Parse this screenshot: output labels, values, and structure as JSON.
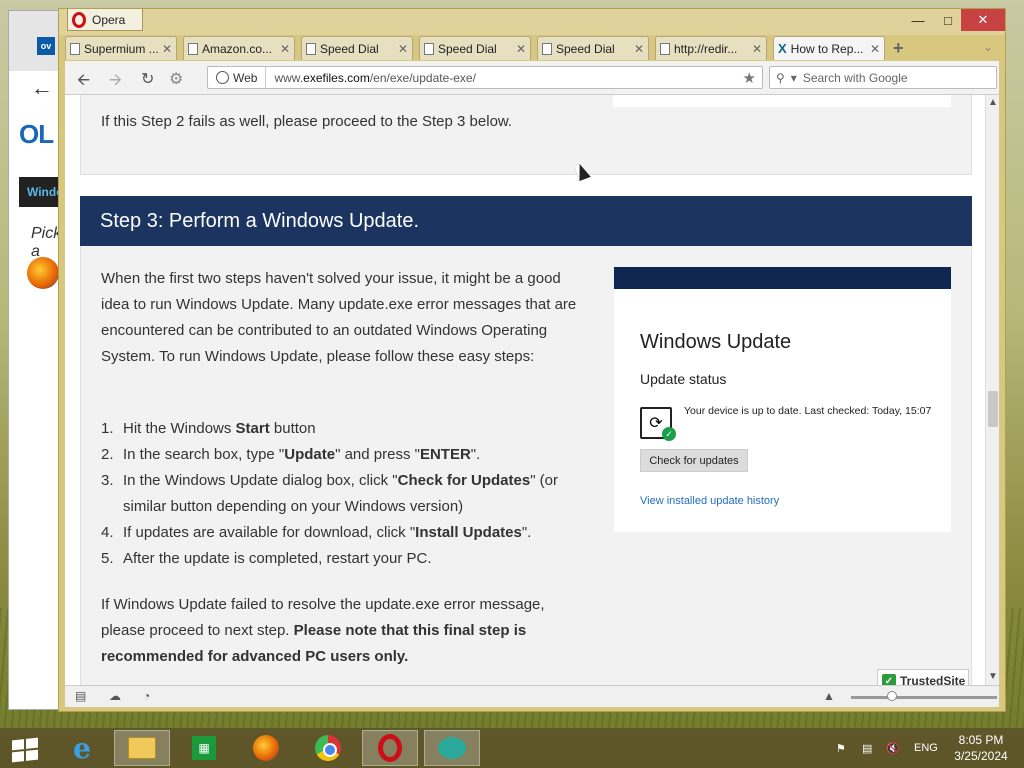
{
  "background_window": {
    "badge": "ov",
    "logo_text": "OL",
    "nav_text": "Window",
    "pick_text": "Pick a"
  },
  "browser": {
    "app_name": "Opera",
    "tabs": [
      {
        "label": "Supermium ...",
        "active": false
      },
      {
        "label": "Amazon.co...",
        "active": false
      },
      {
        "label": "Speed Dial",
        "active": false
      },
      {
        "label": "Speed Dial",
        "active": false
      },
      {
        "label": "Speed Dial",
        "active": false
      },
      {
        "label": "http://redir...",
        "active": false
      },
      {
        "label": "How to Rep...",
        "active": true
      }
    ],
    "address": {
      "web_label": "Web",
      "url_prefix": "www.",
      "url_domain": "exefiles.com",
      "url_path": "/en/exe/update-exe/"
    },
    "search_placeholder": "Search with Google"
  },
  "page": {
    "prev_step_text": "If this Step 2 fails as well, please proceed to the Step 3 below.",
    "step3": {
      "heading": "Step 3: Perform a Windows Update.",
      "intro": "When the first two steps haven't solved your issue, it might be a good idea to run Windows Update. Many update.exe error messages that are encountered can be contributed to an outdated Windows Operating System. To run Windows Update, please follow these easy steps:",
      "steps": [
        {
          "num": "1.",
          "pre": "Hit the Windows ",
          "bold": "Start",
          "post": " button"
        },
        {
          "num": "2.",
          "pre": "In the search box, type \"",
          "bold": "Update",
          "post": "\" and press \"",
          "bold2": "ENTER",
          "post2": "\"."
        },
        {
          "num": "3.",
          "pre": "In the Windows Update dialog box, click \"",
          "bold": "Check for Updates",
          "post": "\" (or similar button depending on your Windows version)"
        },
        {
          "num": "4.",
          "pre": "If updates are available for download, click \"",
          "bold": "Install Updates",
          "post": "\"."
        },
        {
          "num": "5.",
          "pre": "After the update is completed, restart your PC.",
          "bold": "",
          "post": ""
        }
      ],
      "outro_plain": "If Windows Update failed to resolve the update.exe error message, please proceed to next step. ",
      "outro_bold": "Please note that this final step is recommended for advanced PC users only."
    },
    "windows_update_card": {
      "title": "Windows Update",
      "subtitle": "Update status",
      "status": "Your device is up to date. Last checked: Today, 15:07",
      "button": "Check for updates",
      "link": "View installed update history"
    },
    "trusted_badge": "TrustedSite"
  },
  "taskbar": {
    "items": [
      "start",
      "internet-explorer",
      "file-explorer",
      "store",
      "firefox",
      "chrome",
      "opera",
      "messenger"
    ],
    "language": "ENG",
    "time": "8:05 PM",
    "date": "3/25/2024"
  },
  "colors": {
    "step_header": "#1c3460",
    "opera_frame": "#d7c77f",
    "link": "#1f6fbf"
  }
}
